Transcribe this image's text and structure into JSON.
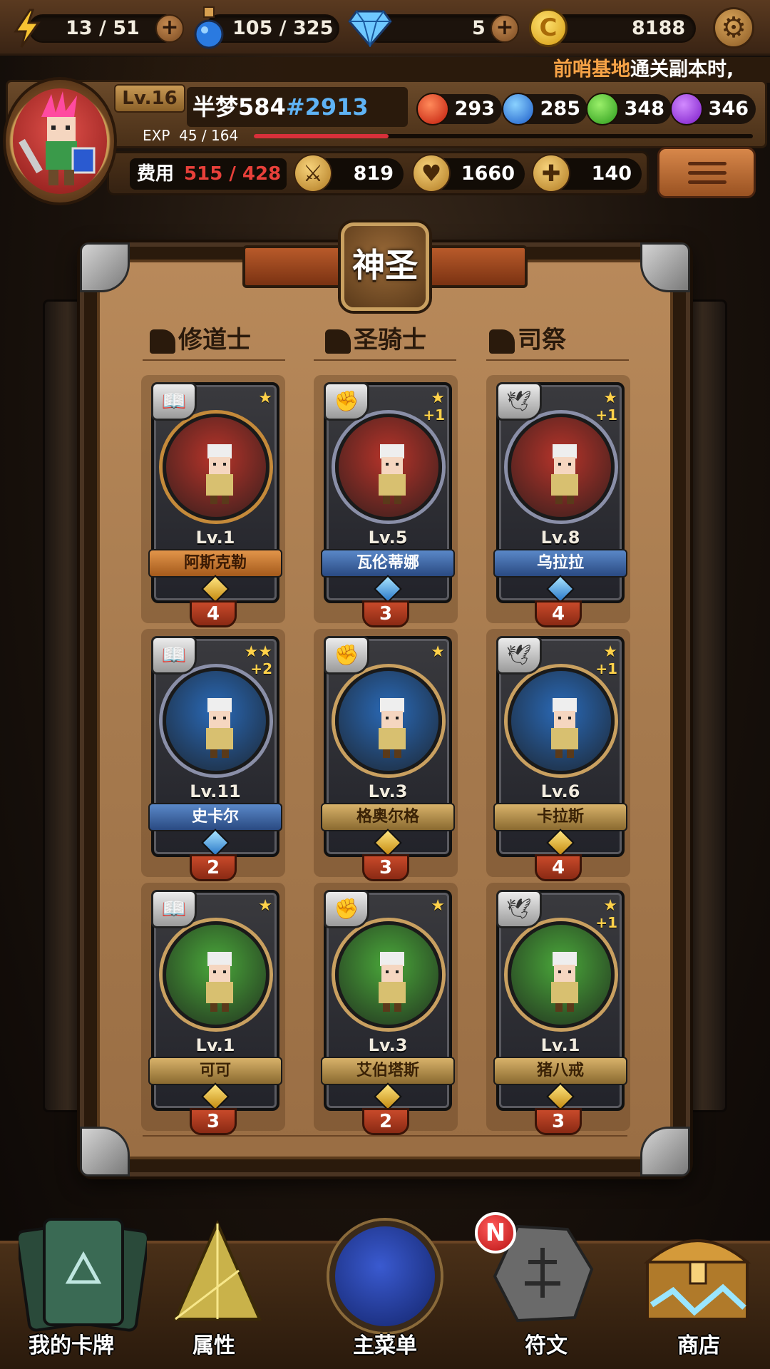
{
  "resources": {
    "energy": "13 / 51",
    "potion": "105 / 325",
    "diamond": "5",
    "gold": "8188"
  },
  "marquee": {
    "highlight": "前哨基地",
    "text": "通关副本时,"
  },
  "player": {
    "level": "Lv.16",
    "name": "半梦584",
    "tag": "#2913",
    "exp_label": "EXP",
    "exp_value": "45 / 164",
    "exp_fraction": 0.27,
    "elements": {
      "fire": "293",
      "water": "285",
      "nature": "348",
      "dark": "346"
    },
    "cost_label": "费用",
    "cost_value": "515 / 428",
    "attack": "819",
    "hp": "1660",
    "heal": "140"
  },
  "deck": {
    "title": "神圣",
    "columns": [
      "修道士",
      "圣骑士",
      "司祭"
    ],
    "cards": [
      {
        "level": "Lv.1",
        "name": "阿斯克勒",
        "stars": "★",
        "plus": "",
        "cost": "4",
        "plate": "orange",
        "bg": "#b8342a",
        "ring": "#c58a3a"
      },
      {
        "level": "Lv.5",
        "name": "瓦伦蒂娜",
        "stars": "★",
        "plus": "+1",
        "cost": "3",
        "plate": "blue",
        "bg": "#b8342a",
        "ring": "#8a8fa8"
      },
      {
        "level": "Lv.8",
        "name": "乌拉拉",
        "stars": "★",
        "plus": "+1",
        "cost": "4",
        "plate": "blue",
        "bg": "#b8342a",
        "ring": "#8a8fa8"
      },
      {
        "level": "Lv.11",
        "name": "史卡尔",
        "stars": "★★",
        "plus": "+2",
        "cost": "2",
        "plate": "blue",
        "bg": "#2a6ab8",
        "ring": "#8a8fa8"
      },
      {
        "level": "Lv.3",
        "name": "格奥尔格",
        "stars": "★",
        "plus": "",
        "cost": "3",
        "plate": "gold",
        "bg": "#2a6ab8",
        "ring": "#c9a060"
      },
      {
        "level": "Lv.6",
        "name": "卡拉斯",
        "stars": "★",
        "plus": "+1",
        "cost": "4",
        "plate": "gold",
        "bg": "#2a6ab8",
        "ring": "#c9a060"
      },
      {
        "level": "Lv.1",
        "name": "可可",
        "stars": "★",
        "plus": "",
        "cost": "3",
        "plate": "gold",
        "bg": "#4aa83a",
        "ring": "#c9a060"
      },
      {
        "level": "Lv.3",
        "name": "艾伯塔斯",
        "stars": "★",
        "plus": "",
        "cost": "2",
        "plate": "gold",
        "bg": "#4aa83a",
        "ring": "#c9a060"
      },
      {
        "level": "Lv.1",
        "name": "猪八戒",
        "stars": "★",
        "plus": "+1",
        "cost": "3",
        "plate": "gold",
        "bg": "#4aa83a",
        "ring": "#c9a060"
      }
    ]
  },
  "nav": {
    "my_cards": "我的卡牌",
    "attributes": "属性",
    "main_menu": "主菜单",
    "runes": "符文",
    "shop": "商店",
    "new_badge": "N"
  },
  "icons": {
    "energy": "lightning-icon",
    "potion": "potion-icon",
    "diamond": "diamond-icon",
    "gold": "gold-coin-icon",
    "settings": "gear-icon",
    "menu": "hamburger-icon"
  }
}
